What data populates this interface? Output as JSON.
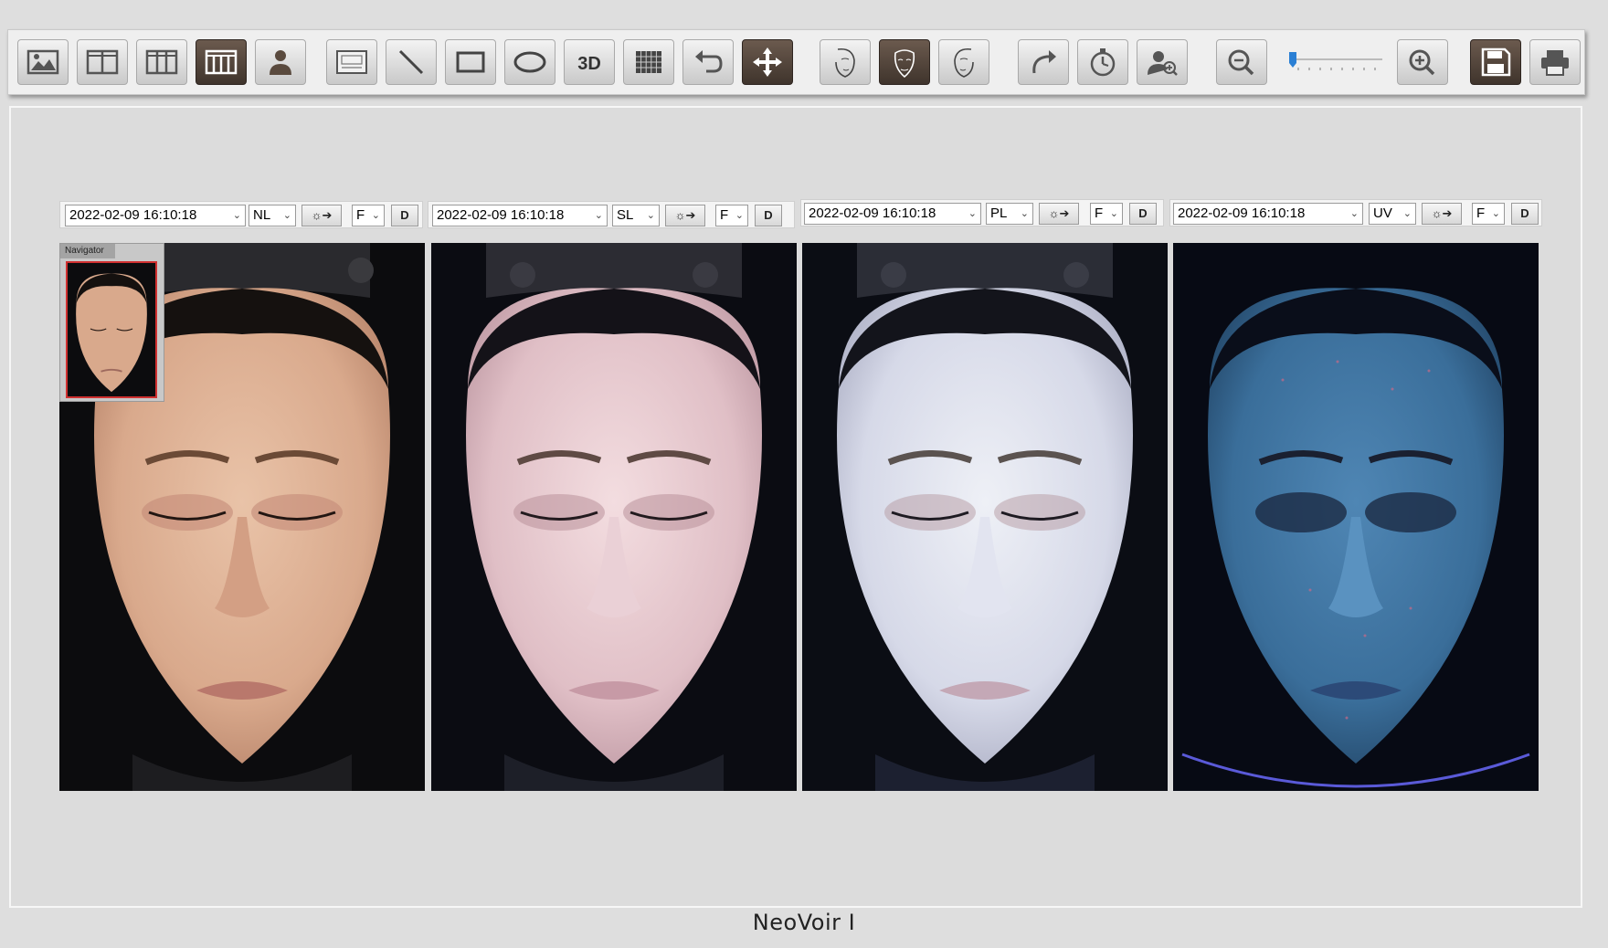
{
  "toolbar": {
    "buttons": [
      {
        "icon": "single-image-icon",
        "active": false
      },
      {
        "icon": "two-panel-icon",
        "active": false
      },
      {
        "icon": "three-panel-icon",
        "active": false
      },
      {
        "icon": "four-panel-icon",
        "active": true
      },
      {
        "icon": "person-icon",
        "active": false
      },
      {
        "icon": "text-annotation-icon",
        "active": false
      },
      {
        "icon": "line-tool-icon",
        "active": false
      },
      {
        "icon": "rectangle-tool-icon",
        "active": false
      },
      {
        "icon": "ellipse-tool-icon",
        "active": false
      },
      {
        "icon": "3d-view-icon",
        "label": "3D",
        "active": false
      },
      {
        "icon": "grid-icon",
        "active": false
      },
      {
        "icon": "undo-icon",
        "active": false
      },
      {
        "icon": "move-icon",
        "active": true
      },
      {
        "icon": "face-left-icon",
        "active": false
      },
      {
        "icon": "face-front-icon",
        "active": true
      },
      {
        "icon": "face-right-icon",
        "active": false
      },
      {
        "icon": "redo-icon",
        "active": false
      },
      {
        "icon": "timer-icon",
        "active": false
      },
      {
        "icon": "face-zoom-icon",
        "active": false
      },
      {
        "icon": "zoom-out-icon",
        "active": false
      },
      {
        "icon": "zoom-in-icon",
        "active": false
      },
      {
        "icon": "save-icon",
        "active": true
      },
      {
        "icon": "print-icon",
        "active": false
      }
    ],
    "zoom_level": 0.0
  },
  "panels": [
    {
      "datetime": "2022-02-09 16:10:18",
      "mode": "NL",
      "side": "F",
      "d_label": "D",
      "light_icon": "light-arrow-icon"
    },
    {
      "datetime": "2022-02-09 16:10:18",
      "mode": "SL",
      "side": "F",
      "d_label": "D",
      "light_icon": "light-arrow-icon"
    },
    {
      "datetime": "2022-02-09 16:10:18",
      "mode": "PL",
      "side": "F",
      "d_label": "D",
      "light_icon": "light-arrow-icon"
    },
    {
      "datetime": "2022-02-09 16:10:18",
      "mode": "UV",
      "side": "F",
      "d_label": "D",
      "light_icon": "light-arrow-icon"
    }
  ],
  "navigator": {
    "title": "Navigator"
  },
  "brand": "NeoVoir I",
  "colors": {
    "accent_dark": "#4a3d33",
    "photo_bg": "#0b0b0d",
    "uv_tint": "#3a6e9a"
  }
}
